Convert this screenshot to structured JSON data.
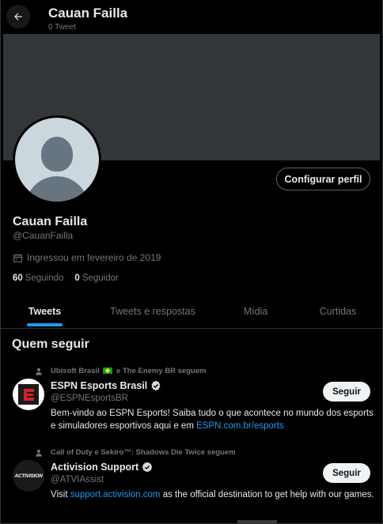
{
  "header": {
    "title": "Cauan Failla",
    "subtitle": "0 Tweet"
  },
  "profile": {
    "name": "Cauan Failla",
    "handle": "@CauanFailla",
    "joined": "Ingressou em fevereiro de 2019",
    "following_count": "60",
    "following_label": "Seguindo",
    "followers_count": "0",
    "followers_label": "Seguidor",
    "edit_button": "Configurar perfil"
  },
  "tabs": [
    {
      "label": "Tweets",
      "active": true
    },
    {
      "label": "Tweets e respostas",
      "active": false
    },
    {
      "label": "Mídia",
      "active": false
    },
    {
      "label": "Curtidas",
      "active": false
    }
  ],
  "who_to_follow": {
    "title": "Quem seguir",
    "follow_label": "Seguir",
    "accounts": [
      {
        "social_a": "Ubisoft Brasil",
        "social_b": "e The Enemy BR seguem",
        "name": "ESPN Esports Brasil",
        "handle": "@ESPNEsportsBR",
        "bio_text": "Bem-vindo ao ESPN Esports! Saiba tudo o que acontece no mundo dos esports e simuladores esportivos aqui e em ",
        "bio_link": "ESPN.com.br/esports",
        "bio_after": "",
        "verified": true
      },
      {
        "social_a": "Call of Duty e Sekiro™: Shadows Die Twice seguem",
        "social_b": "",
        "name": "Activision Support",
        "handle": "@ATVIAssist",
        "bio_text": "Visit ",
        "bio_link": "support.activision.com",
        "bio_after": " as the official destination to get help with our games.",
        "avatar_text": "ACTIVISION",
        "verified": true
      }
    ]
  },
  "colors": {
    "accent": "#1d9bf0",
    "background": "#000000",
    "banner": "#333639",
    "muted": "#71767b"
  }
}
